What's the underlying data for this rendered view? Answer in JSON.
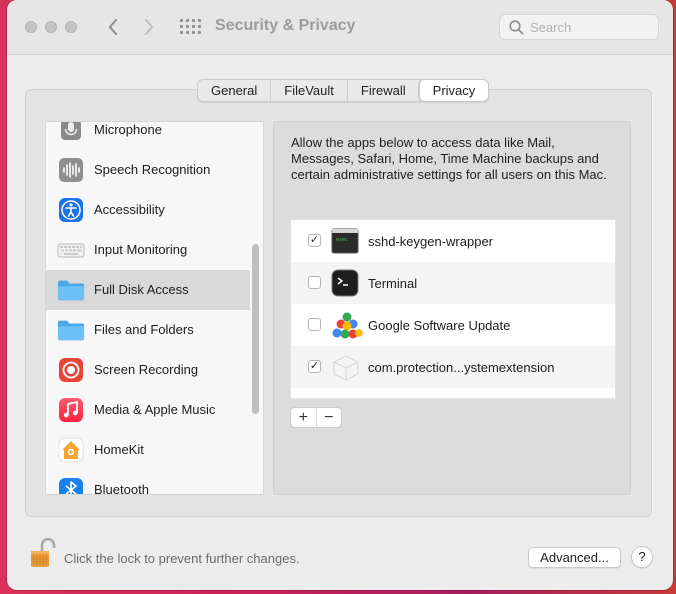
{
  "window": {
    "title": "Security & Privacy"
  },
  "search": {
    "placeholder": "Search"
  },
  "tabs": [
    {
      "label": "General",
      "active": false
    },
    {
      "label": "FileVault",
      "active": false
    },
    {
      "label": "Firewall",
      "active": false
    },
    {
      "label": "Privacy",
      "active": true
    }
  ],
  "sidebar": {
    "items": [
      {
        "label": "Microphone",
        "icon": "microphone-icon"
      },
      {
        "label": "Speech Recognition",
        "icon": "waveform-icon"
      },
      {
        "label": "Accessibility",
        "icon": "accessibility-icon"
      },
      {
        "label": "Input Monitoring",
        "icon": "keyboard-icon"
      },
      {
        "label": "Full Disk Access",
        "icon": "folder-icon",
        "selected": true
      },
      {
        "label": "Files and Folders",
        "icon": "folder-icon"
      },
      {
        "label": "Screen Recording",
        "icon": "screen-record-icon"
      },
      {
        "label": "Media & Apple Music",
        "icon": "music-note-icon"
      },
      {
        "label": "HomeKit",
        "icon": "home-icon"
      },
      {
        "label": "Bluetooth",
        "icon": "bluetooth-icon"
      }
    ]
  },
  "main": {
    "description": "Allow the apps below to access data like Mail, Messages, Safari, Home, Time Machine backups and certain administrative settings for all users on this Mac.",
    "apps": [
      {
        "name": "sshd-keygen-wrapper",
        "checked": true,
        "icon": "terminal-exec-icon"
      },
      {
        "name": "Terminal",
        "checked": false,
        "icon": "terminal-icon"
      },
      {
        "name": "Google Software Update",
        "checked": false,
        "icon": "google-update-icon"
      },
      {
        "name": "com.protection...ystemextension",
        "checked": true,
        "icon": "system-extension-icon"
      }
    ],
    "add_label": "+",
    "remove_label": "−"
  },
  "footer": {
    "lock_text": "Click the lock to prevent further changes.",
    "advanced_label": "Advanced...",
    "help_label": "?"
  },
  "colors": {
    "accent": "#0a84ff",
    "selected_row": "#d9d9d9"
  }
}
